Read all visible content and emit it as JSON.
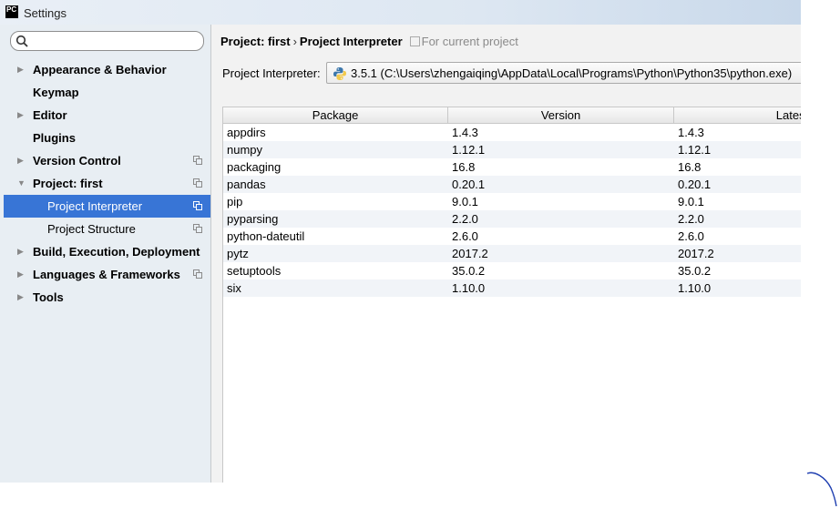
{
  "window": {
    "title": "Settings",
    "logo_text": "PC"
  },
  "sidebar": {
    "search_placeholder": "",
    "items": [
      {
        "label": "Appearance & Behavior",
        "arrow": "▶",
        "copy": false,
        "child": false,
        "selected": false
      },
      {
        "label": "Keymap",
        "arrow": "",
        "copy": false,
        "child": false,
        "selected": false
      },
      {
        "label": "Editor",
        "arrow": "▶",
        "copy": false,
        "child": false,
        "selected": false
      },
      {
        "label": "Plugins",
        "arrow": "",
        "copy": false,
        "child": false,
        "selected": false
      },
      {
        "label": "Version Control",
        "arrow": "▶",
        "copy": true,
        "child": false,
        "selected": false
      },
      {
        "label": "Project: first",
        "arrow": "▼",
        "copy": true,
        "child": false,
        "selected": false
      },
      {
        "label": "Project Interpreter",
        "arrow": "",
        "copy": true,
        "child": true,
        "selected": true
      },
      {
        "label": "Project Structure",
        "arrow": "",
        "copy": true,
        "child": true,
        "selected": false
      },
      {
        "label": "Build, Execution, Deployment",
        "arrow": "▶",
        "copy": false,
        "child": false,
        "selected": false
      },
      {
        "label": "Languages & Frameworks",
        "arrow": "▶",
        "copy": true,
        "child": false,
        "selected": false
      },
      {
        "label": "Tools",
        "arrow": "▶",
        "copy": false,
        "child": false,
        "selected": false
      }
    ]
  },
  "breadcrumb": {
    "project": "Project: first",
    "separator": "›",
    "page": "Project Interpreter",
    "scope_note": "For current project"
  },
  "interpreter": {
    "label": "Project Interpreter:",
    "value": "3.5.1 (C:\\Users\\zhengaiqing\\AppData\\Local\\Programs\\Python\\Python35\\python.exe)"
  },
  "table": {
    "headers": {
      "package": "Package",
      "version": "Version",
      "latest": "Latest"
    },
    "rows": [
      {
        "name": "appdirs",
        "version": "1.4.3",
        "latest": "1.4.3"
      },
      {
        "name": "numpy",
        "version": "1.12.1",
        "latest": "1.12.1"
      },
      {
        "name": "packaging",
        "version": "16.8",
        "latest": "16.8"
      },
      {
        "name": "pandas",
        "version": "0.20.1",
        "latest": "0.20.1"
      },
      {
        "name": "pip",
        "version": "9.0.1",
        "latest": "9.0.1"
      },
      {
        "name": "pyparsing",
        "version": "2.2.0",
        "latest": "2.2.0"
      },
      {
        "name": "python-dateutil",
        "version": "2.6.0",
        "latest": "2.6.0"
      },
      {
        "name": "pytz",
        "version": "2017.2",
        "latest": "2017.2"
      },
      {
        "name": "setuptools",
        "version": "35.0.2",
        "latest": "35.0.2"
      },
      {
        "name": "six",
        "version": "1.10.0",
        "latest": "1.10.0"
      }
    ]
  },
  "colors": {
    "selection": "#3875d6",
    "sidebar_bg": "#e8eef3",
    "row_alt": "#f1f4f8",
    "pen_mark": "#1f3fb0"
  },
  "icons": {
    "search": "search-icon",
    "copy": "project-scope-icon",
    "python": "python-icon"
  }
}
